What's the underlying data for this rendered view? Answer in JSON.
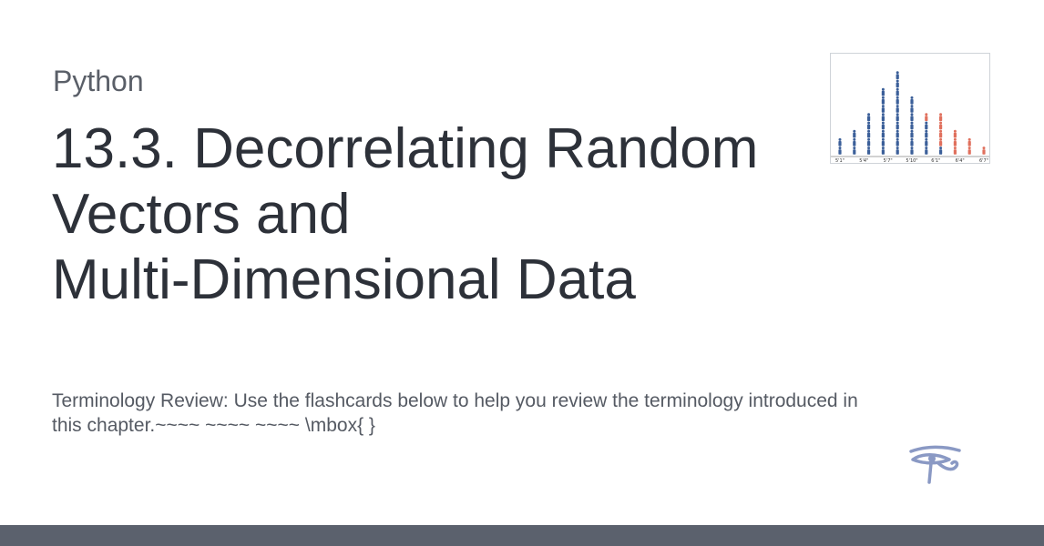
{
  "site": {
    "name": "Python"
  },
  "page": {
    "title_lines": [
      "13.3. Decorrelating Random",
      "Vectors and",
      "Multi-Dimensional Data"
    ],
    "description_lines": [
      "Terminology Review: Use the flashcards below to help you review the terminology introduced in",
      "this chapter.~~~~ ~~~~ ~~~~ \\mbox{ }"
    ]
  },
  "thumbnail": {
    "axis_ticks": [
      "5'1\"",
      "5'4\"",
      "5'7\"",
      "5'10\"",
      "6'1\"",
      "6'4\"",
      "6'7\""
    ],
    "column_counts_blue": [
      2,
      3,
      5,
      8,
      10,
      7,
      4,
      1,
      0,
      0,
      0
    ],
    "column_counts_red": [
      0,
      0,
      0,
      0,
      0,
      0,
      1,
      4,
      3,
      2,
      1
    ],
    "colors": {
      "blue": "#3b5f99",
      "red": "#e0705d"
    }
  },
  "logo": {
    "icon": "eye-of-horus-icon",
    "color": "#8a99c4"
  },
  "colors": {
    "title": "#2d3139",
    "text": "#555a63",
    "footer": "#5b616d"
  }
}
